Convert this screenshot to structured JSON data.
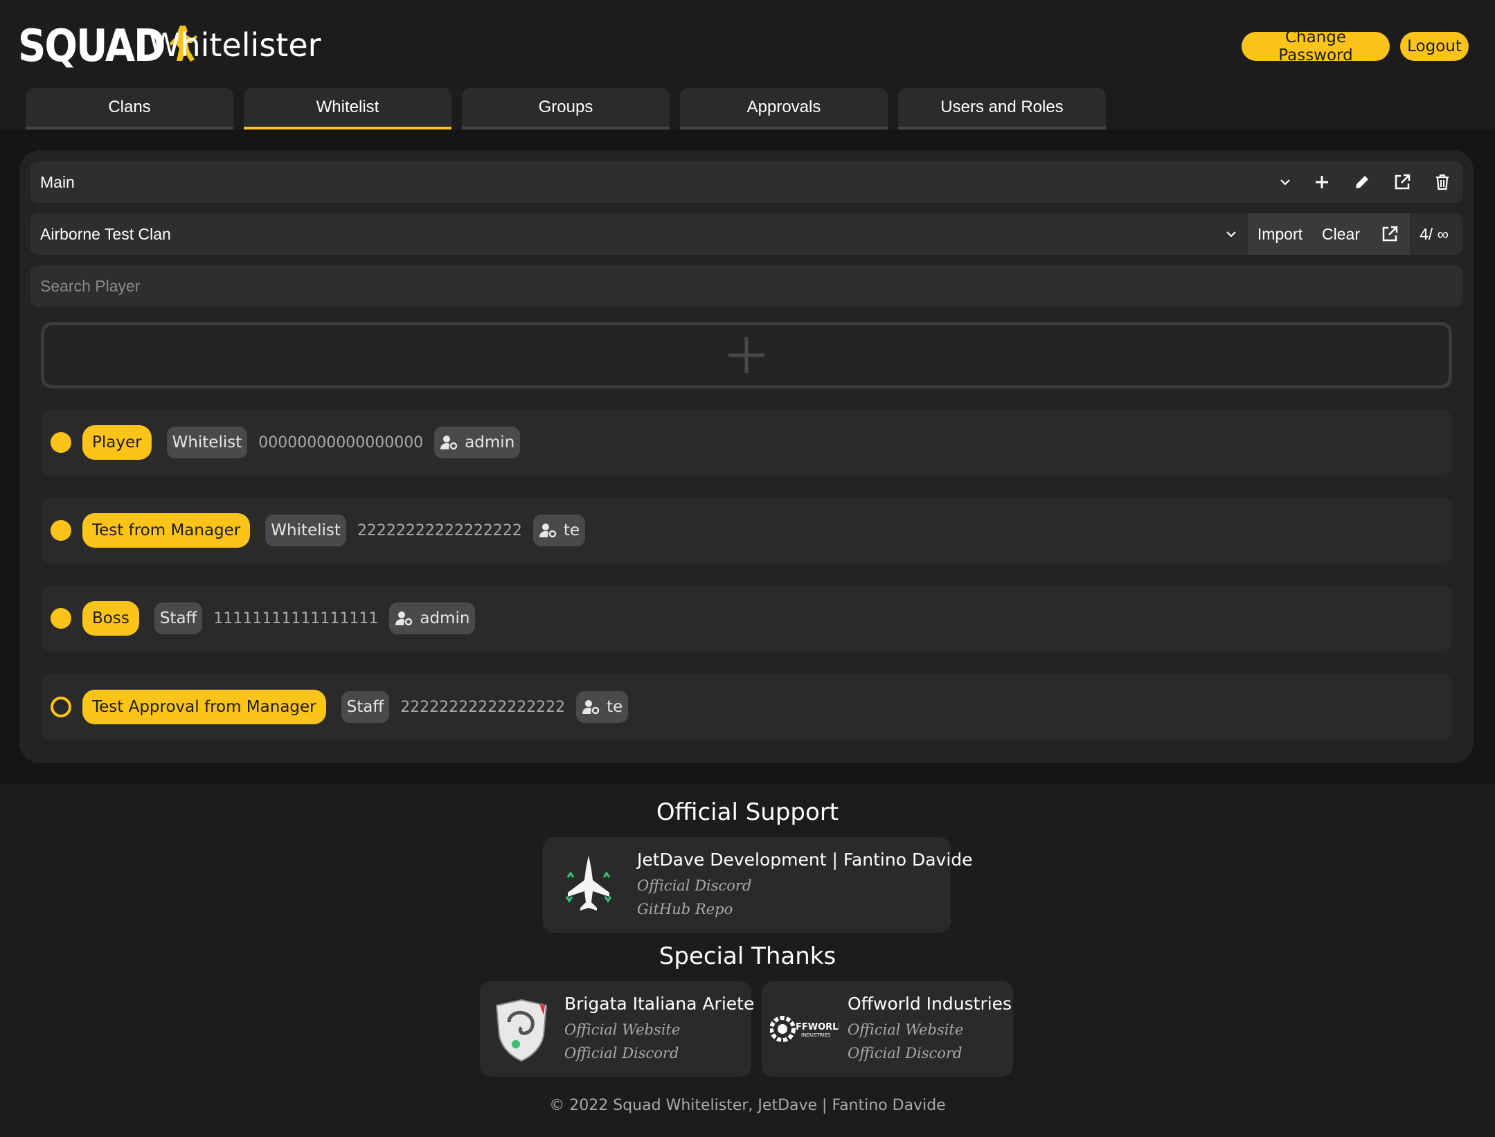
{
  "header": {
    "logo_text": "SQUAD",
    "app_title": "Whitelister",
    "change_password_label": "Change Password",
    "logout_label": "Logout"
  },
  "tabs": [
    {
      "label": "Clans",
      "active": false
    },
    {
      "label": "Whitelist",
      "active": true
    },
    {
      "label": "Groups",
      "active": false
    },
    {
      "label": "Approvals",
      "active": false
    },
    {
      "label": "Users and Roles",
      "active": false
    }
  ],
  "whitelist": {
    "list_select": "Main",
    "clan_select": "Airborne Test Clan",
    "import_label": "Import",
    "clear_label": "Clear",
    "count": "4/ ∞",
    "search_placeholder": "Search Player",
    "accent_color": "#fcc419",
    "players": [
      {
        "name": "Player",
        "group": "Whitelist",
        "steam_id": "00000000000000000",
        "user": "admin",
        "approved": true
      },
      {
        "name": "Test from Manager",
        "group": "Whitelist",
        "steam_id": "22222222222222222",
        "user": "te",
        "approved": true
      },
      {
        "name": "Boss",
        "group": "Staff",
        "steam_id": "11111111111111111",
        "user": "admin",
        "approved": true
      },
      {
        "name": "Test Approval from Manager",
        "group": "Staff",
        "steam_id": "22222222222222222",
        "user": "te",
        "approved": false
      }
    ]
  },
  "footer": {
    "official_support": "Official Support",
    "support_card": {
      "title": "JetDave Development | Fantino Davide",
      "link1": "Official Discord",
      "link2": "GitHub Repo"
    },
    "special_thanks": "Special Thanks",
    "thanks_cards": [
      {
        "title": "Brigata Italiana Ariete",
        "link1": "Official Website",
        "link2": "Official Discord"
      },
      {
        "title": "Offworld Industries",
        "link1": "Official Website",
        "link2": "Official Discord",
        "logo_text": "FFWORLD",
        "logo_subtext": "INDUSTRIES"
      }
    ],
    "copyright": "© 2022 Squad Whitelister, JetDave | Fantino Davide"
  }
}
